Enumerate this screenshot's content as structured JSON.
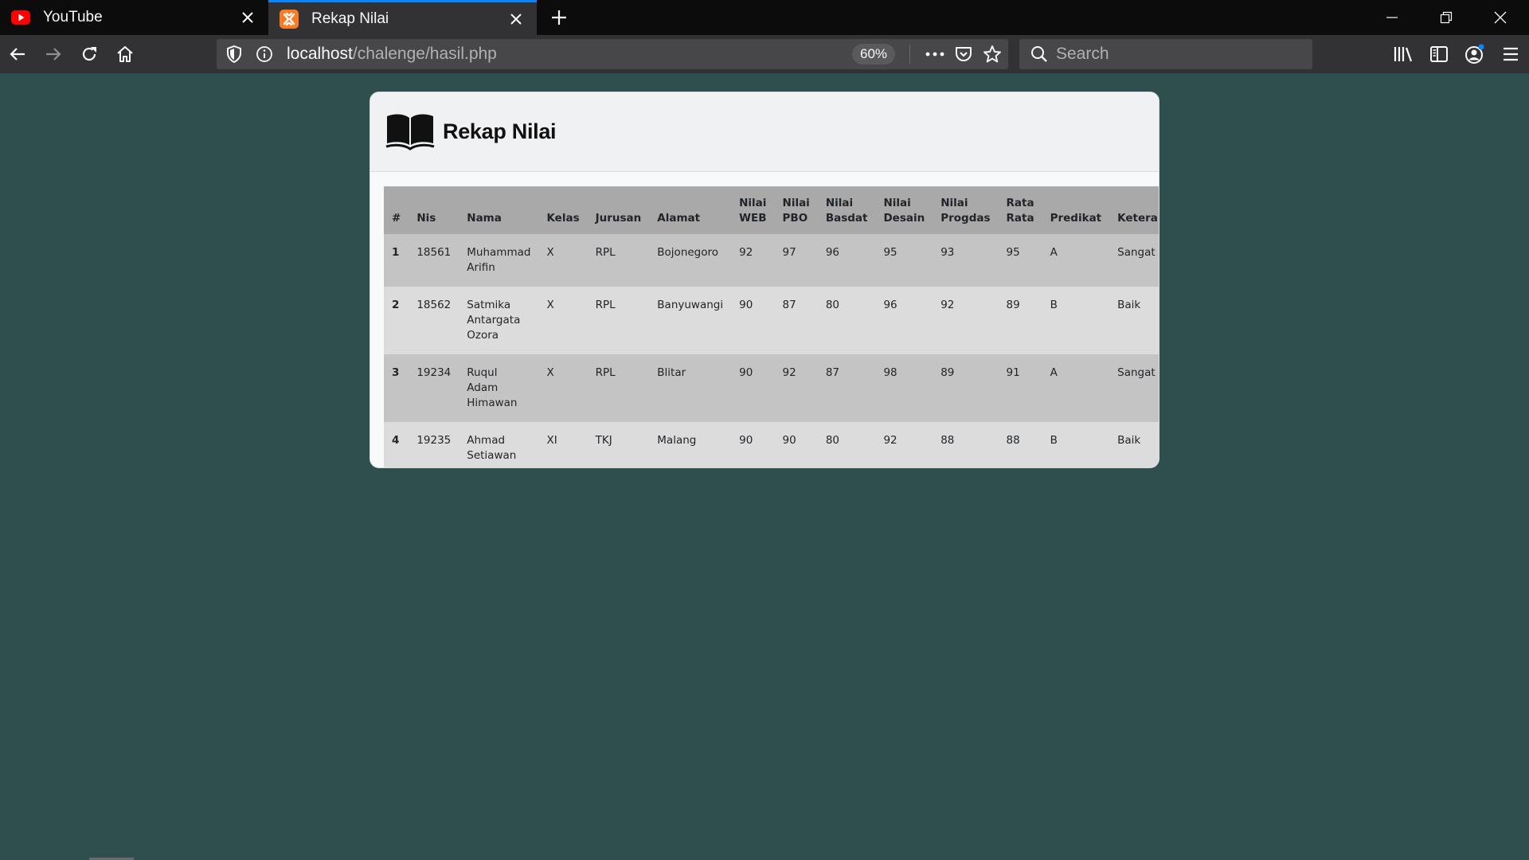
{
  "browser": {
    "tabs": [
      {
        "title": "YouTube",
        "icon": "youtube-icon",
        "active": false
      },
      {
        "title": "Rekap Nilai",
        "icon": "xampp-icon",
        "active": true
      }
    ],
    "url_host": "localhost",
    "url_path": "/chalenge/hasil.php",
    "zoom": "60%",
    "search_placeholder": "Search",
    "accent_color": "#0a84ff"
  },
  "page": {
    "title": "Rekap Nilai",
    "background_color": "#2f4f4f",
    "table": {
      "headers": {
        "no": "#",
        "nis": "Nis",
        "nama": "Nama",
        "kelas": "Kelas",
        "jurusan": "Jurusan",
        "alamat": "Alamat",
        "web": "Nilai WEB",
        "pbo": "Nilai PBO",
        "basdat": "Nilai Basdat",
        "desain": "Nilai Desain",
        "progdas": "Nilai Progdas",
        "rata": "Rata Rata",
        "predikat": "Predikat",
        "keterangan": "Keterangan"
      },
      "rows": [
        {
          "no": "1",
          "nis": "18561",
          "nama": "Muhammad Arifin",
          "kelas": "X",
          "jurusan": "RPL",
          "alamat": "Bojonegoro",
          "web": "92",
          "pbo": "97",
          "basdat": "96",
          "desain": "95",
          "progdas": "93",
          "rata": "95",
          "predikat": "A",
          "keterangan": "Sangat Baik"
        },
        {
          "no": "2",
          "nis": "18562",
          "nama": "Satmika Antargata Ozora",
          "kelas": "X",
          "jurusan": "RPL",
          "alamat": "Banyuwangi",
          "web": "90",
          "pbo": "87",
          "basdat": "80",
          "desain": "96",
          "progdas": "92",
          "rata": "89",
          "predikat": "B",
          "keterangan": "Baik"
        },
        {
          "no": "3",
          "nis": "19234",
          "nama": "Ruqul Adam Himawan",
          "kelas": "X",
          "jurusan": "RPL",
          "alamat": "Blitar",
          "web": "90",
          "pbo": "92",
          "basdat": "87",
          "desain": "98",
          "progdas": "89",
          "rata": "91",
          "predikat": "A",
          "keterangan": "Sangat Baik"
        },
        {
          "no": "4",
          "nis": "19235",
          "nama": "Ahmad Setiawan",
          "kelas": "XI",
          "jurusan": "TKJ",
          "alamat": "Malang",
          "web": "90",
          "pbo": "90",
          "basdat": "80",
          "desain": "92",
          "progdas": "88",
          "rata": "88",
          "predikat": "B",
          "keterangan": "Baik"
        }
      ]
    }
  }
}
